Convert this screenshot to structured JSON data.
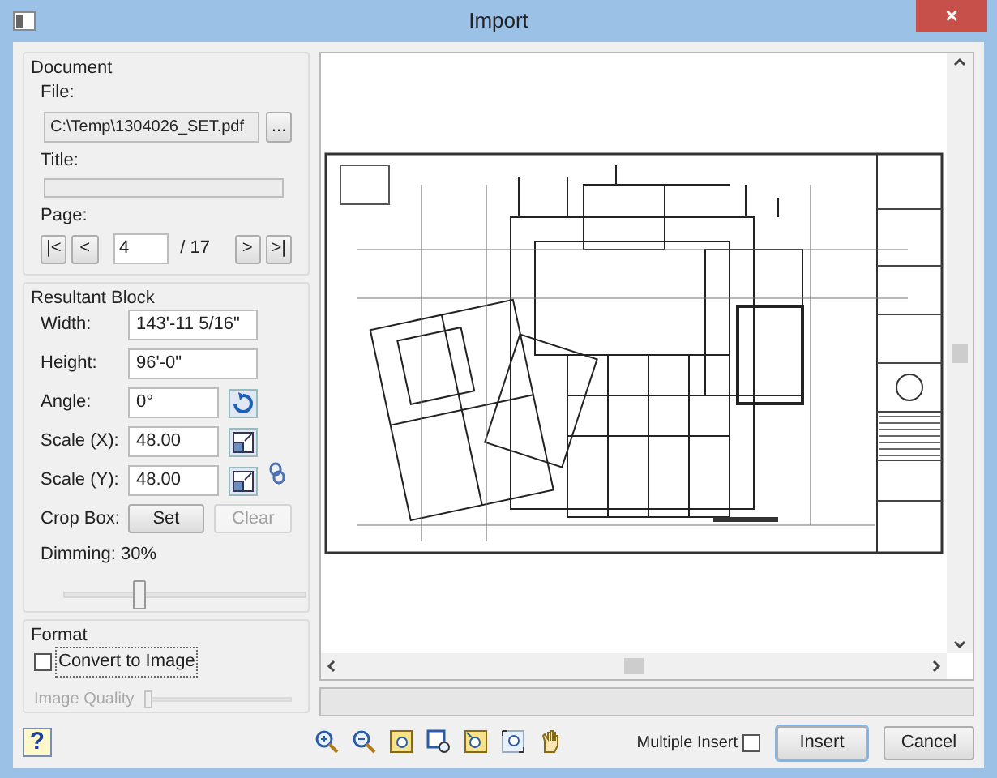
{
  "window": {
    "title": "Import",
    "close": "×"
  },
  "document": {
    "heading": "Document",
    "file_label": "File:",
    "file_value": "C:\\Temp\\1304026_SET.pdf",
    "browse": "...",
    "title_label": "Title:",
    "page_label": "Page:",
    "nav": [
      "|<",
      "<",
      ">",
      ">|"
    ],
    "page_value": "4",
    "page_total": "/ 17"
  },
  "resultant_block": {
    "heading": "Resultant Block",
    "fields": [
      {
        "label": "Width:",
        "value": "143'-11 5/16\"",
        "kind": "plain"
      },
      {
        "label": "Height:",
        "value": "96'-0\"",
        "kind": "plain"
      },
      {
        "label": "Angle:",
        "value": "0°",
        "kind": "rotate"
      },
      {
        "label": "Scale (X):",
        "value": "48.00",
        "kind": "scale"
      },
      {
        "label": "Scale (Y):",
        "value": "48.00",
        "kind": "scale"
      }
    ],
    "crop_label": "Crop Box:",
    "crop_buttons": [
      {
        "label": "Set",
        "disabled": false
      },
      {
        "label": "Clear",
        "disabled": true
      }
    ],
    "dimming": {
      "label": "Dimming: 30%",
      "level": 0.3
    }
  },
  "format": {
    "heading": "Format",
    "convert": {
      "label": "Convert to Image",
      "checked": false
    },
    "quality": {
      "label": "Image Quality",
      "disabled": true,
      "level": 0
    }
  },
  "help": "?",
  "multiple_insert": {
    "label": "Multiple Insert",
    "checked": false
  },
  "buttons": [
    {
      "label": "Insert",
      "default": true
    },
    {
      "label": "Cancel",
      "default": false
    }
  ]
}
